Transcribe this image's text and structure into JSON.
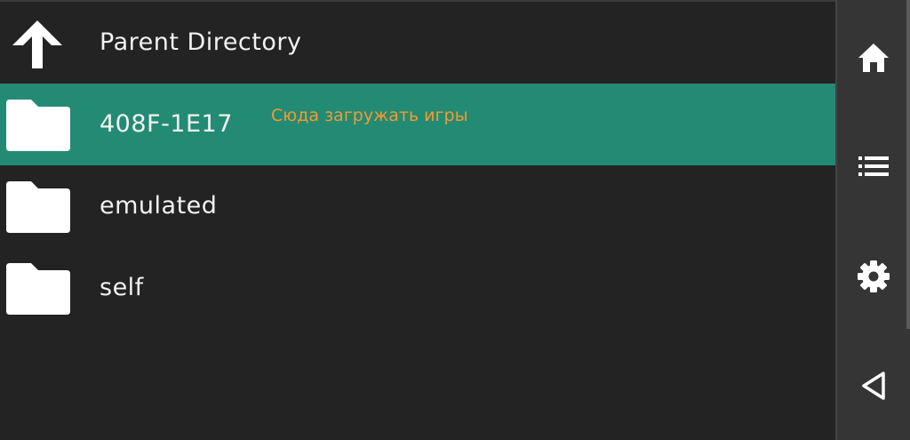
{
  "file_list": {
    "items": [
      {
        "label": "Parent Directory",
        "icon": "arrow-up-icon",
        "selected": false
      },
      {
        "label": "408F-1E17",
        "icon": "folder-icon",
        "selected": true,
        "note": "Сюда загружать игры"
      },
      {
        "label": "emulated",
        "icon": "folder-icon",
        "selected": false
      },
      {
        "label": "self",
        "icon": "folder-icon",
        "selected": false
      }
    ]
  },
  "side_bar": {
    "buttons": [
      {
        "name": "home-button",
        "icon": "home-icon"
      },
      {
        "name": "menu-button",
        "icon": "list-icon"
      },
      {
        "name": "settings-button",
        "icon": "gear-icon"
      },
      {
        "name": "back-button",
        "icon": "back-triangle-icon"
      }
    ]
  },
  "colors": {
    "background": "#232323",
    "selected_row": "#238b73",
    "note_text": "#f39a33",
    "side_bar": "#353535"
  }
}
